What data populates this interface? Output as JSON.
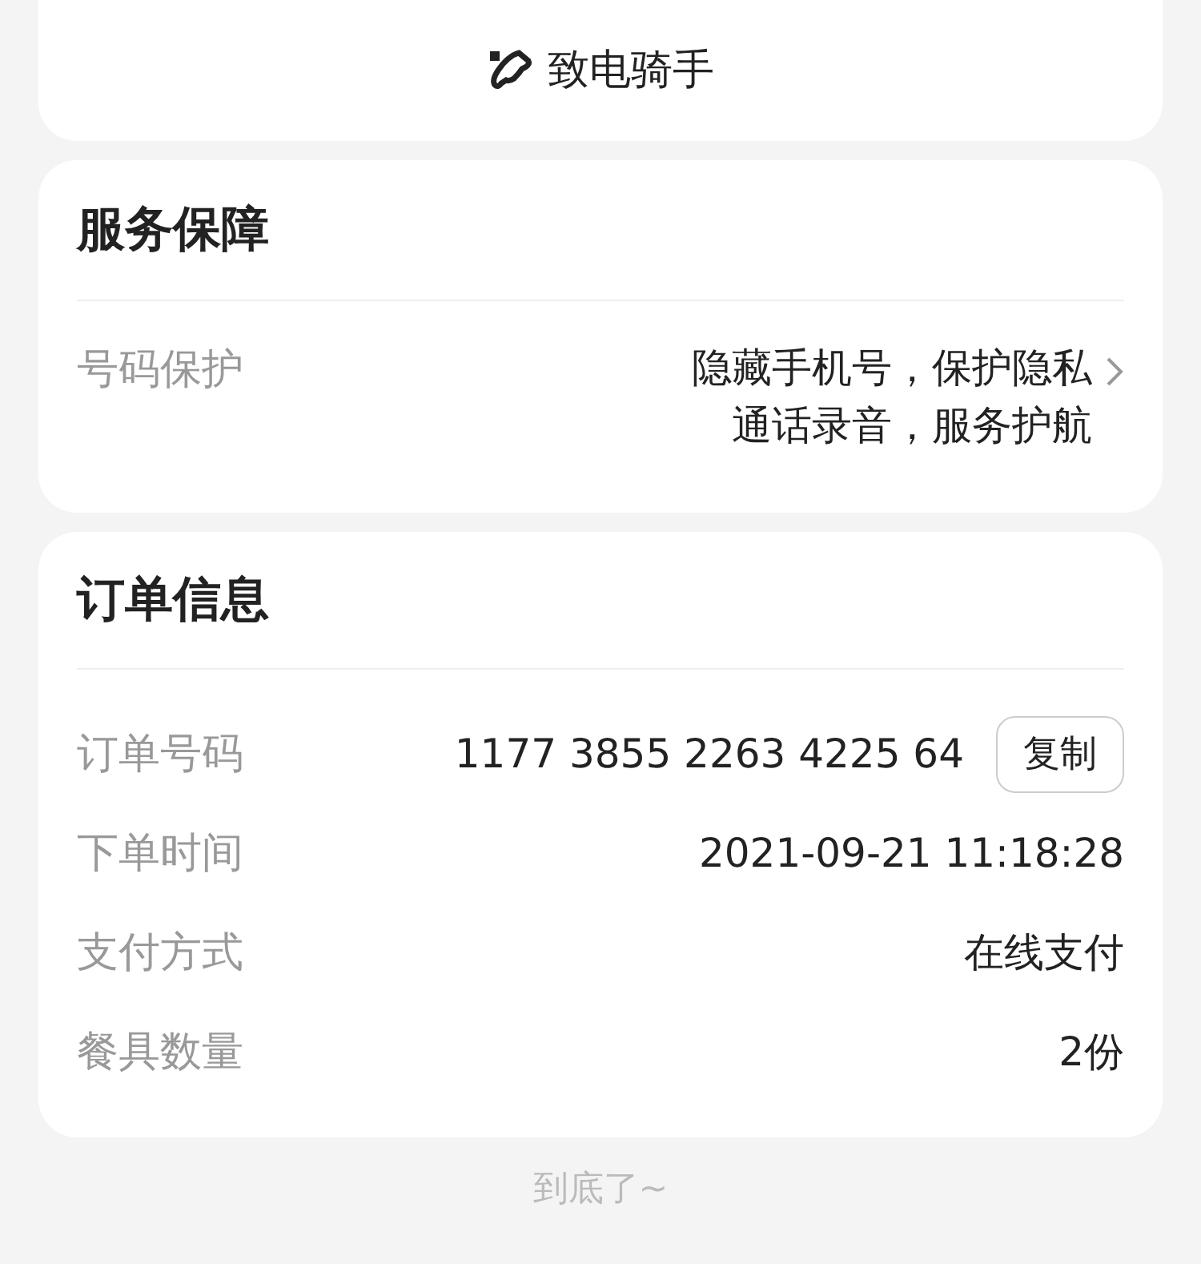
{
  "call_rider": {
    "label": "致电骑手"
  },
  "service": {
    "title": "服务保障",
    "rows": [
      {
        "label": "号码保护",
        "lines": [
          "隐藏手机号，保护隐私",
          "通话录音，服务护航"
        ]
      }
    ]
  },
  "order": {
    "title": "订单信息",
    "rows": [
      {
        "label": "订单号码",
        "value": "1177 3855 2263 4225 64",
        "button": "复制"
      },
      {
        "label": "下单时间",
        "value": "2021-09-21 11:18:28"
      },
      {
        "label": "支付方式",
        "value": "在线支付"
      },
      {
        "label": "餐具数量",
        "value": "2份"
      }
    ]
  },
  "footer": "到底了~"
}
